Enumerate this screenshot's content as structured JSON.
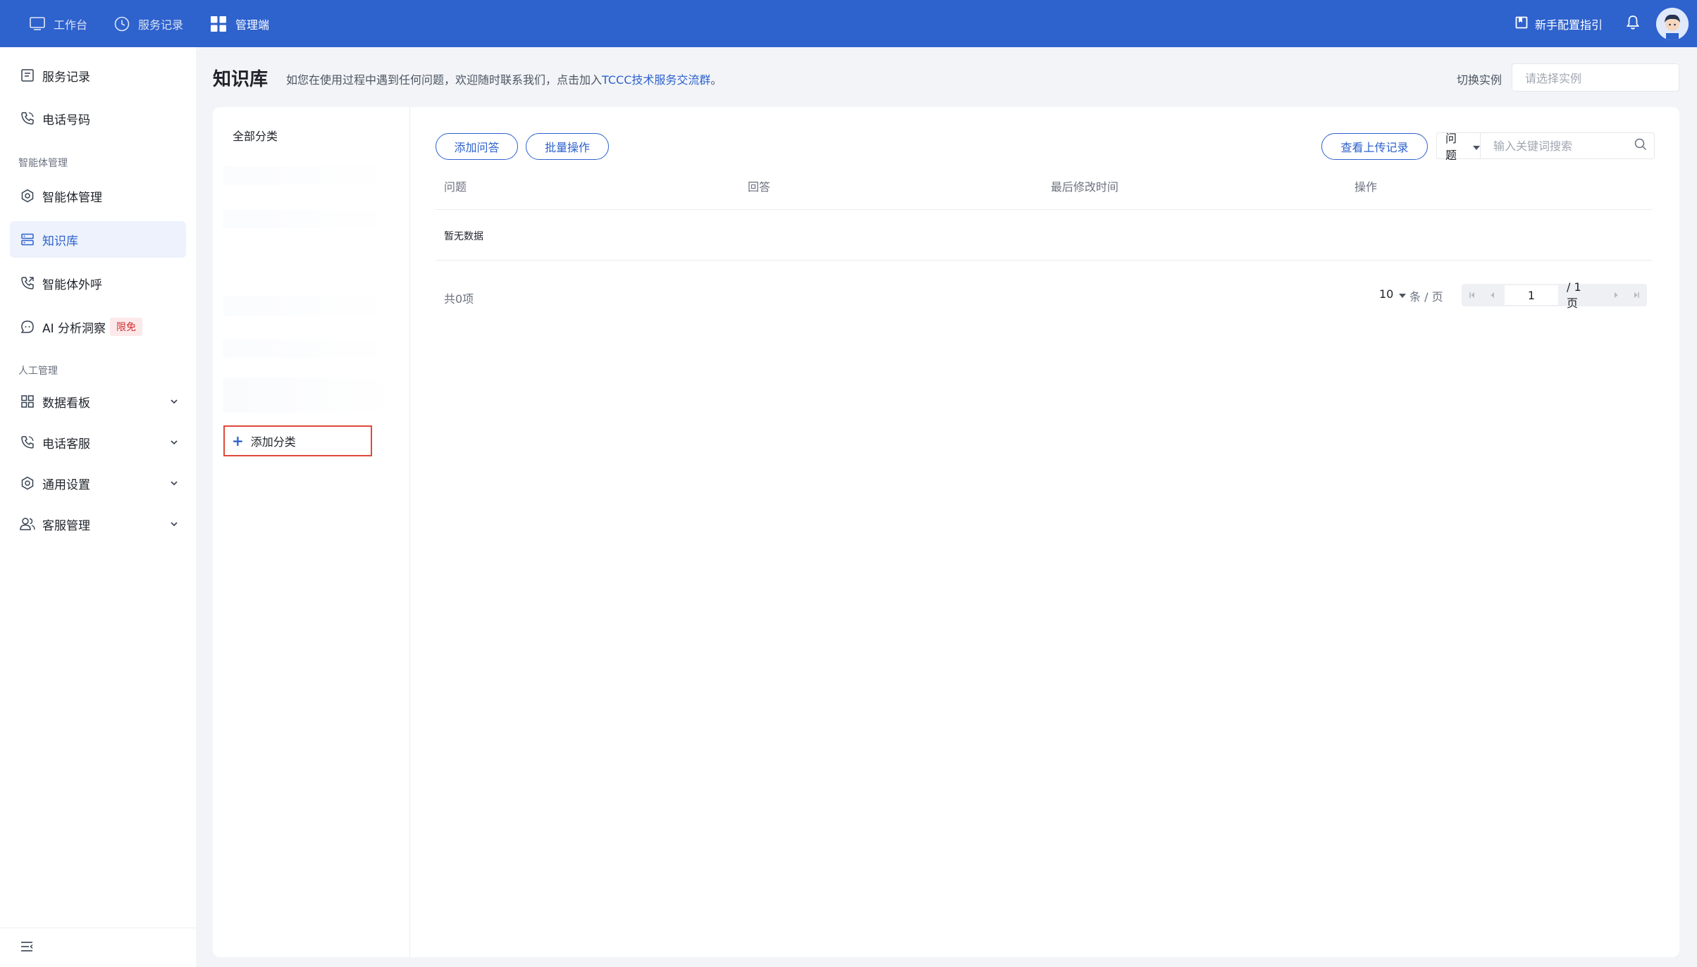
{
  "topbar": {
    "nav": [
      {
        "label": "工作台",
        "icon": "monitor-icon"
      },
      {
        "label": "服务记录",
        "icon": "clock-icon"
      },
      {
        "label": "管理端",
        "icon": "grid-icon"
      }
    ],
    "guide_label": "新手配置指引",
    "accent_color": "#2e62cd"
  },
  "sidebar": {
    "items": [
      {
        "label": "服务记录",
        "icon": "document-icon"
      },
      {
        "label": "电话号码",
        "icon": "phone-icon"
      },
      {
        "group": "智能体管理"
      },
      {
        "label": "智能体管理",
        "icon": "hexagon-settings-icon"
      },
      {
        "label": "知识库",
        "icon": "database-icon",
        "active": true
      },
      {
        "label": "智能体外呼",
        "icon": "phone-outbound-icon"
      },
      {
        "label": "AI 分析洞察",
        "icon": "chat-bot-icon",
        "badge": "限免"
      },
      {
        "group": "人工管理"
      },
      {
        "label": "数据看板",
        "icon": "dashboard-grid-icon"
      },
      {
        "label": "电话客服",
        "icon": "phone-support-icon"
      },
      {
        "label": "通用设置",
        "icon": "gear-icon"
      },
      {
        "label": "客服管理",
        "icon": "users-icon"
      }
    ]
  },
  "header": {
    "title": "知识库",
    "desc_prefix": "如您在使用过程中遇到任何问题，欢迎随时联系我们，点击加入",
    "desc_link": "TCCC技术服务交流群",
    "desc_suffix": "。",
    "switch_label": "切换实例",
    "instance_placeholder": "请选择实例"
  },
  "categories": {
    "all_label": "全部分类",
    "add_label": "添加分类"
  },
  "toolbar": {
    "add_qa": "添加问答",
    "batch": "批量操作",
    "view_uploads": "查看上传记录",
    "search_type": "问题",
    "search_placeholder": "输入关键词搜索"
  },
  "table": {
    "columns": [
      "问题",
      "回答",
      "最后修改时间",
      "操作"
    ],
    "empty_text": "暂无数据",
    "total": "共0项"
  },
  "pager": {
    "page_size": "10",
    "unit": "条 / 页",
    "current_page": "1",
    "total_pages": "/ 1 页"
  }
}
